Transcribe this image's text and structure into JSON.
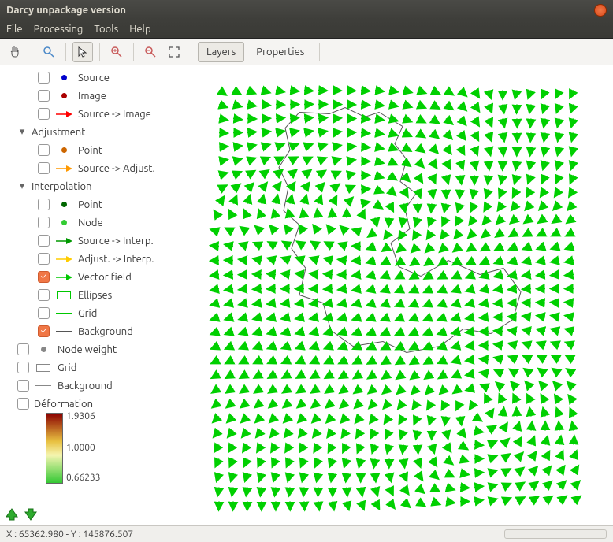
{
  "window": {
    "title": "Darcy unpackage version"
  },
  "menu": {
    "file": "File",
    "processing": "Processing",
    "tools": "Tools",
    "help": "Help"
  },
  "toolbar": {
    "layers": "Layers",
    "properties": "Properties"
  },
  "tree": {
    "source": "Source",
    "image": "Image",
    "source_image": "Source -> Image",
    "adjustment": "Adjustment",
    "adj_point": "Point",
    "adj_source": "Source -> Adjust.",
    "interpolation": "Interpolation",
    "int_point": "Point",
    "int_node": "Node",
    "int_source": "Source -> Interp.",
    "int_adjust": "Adjust. -> Interp.",
    "vector_field": "Vector field",
    "ellipses": "Ellipses",
    "int_grid": "Grid",
    "int_background": "Background",
    "node_weight": "Node weight",
    "grid": "Grid",
    "background": "Background",
    "deformation": "Déformation",
    "grad_max": "1.9306",
    "grad_mid": "1.0000",
    "grad_min": "0.66233"
  },
  "status": {
    "coords": "X : 65362.980 - Y : 145876.507"
  },
  "colors": {
    "vector": "#00d000",
    "source_dot": "#0000cc",
    "image_dot": "#aa0000",
    "adj_point": "#cc6600",
    "int_point": "#006600",
    "int_node": "#33cc33",
    "src_img_arrow": "#ff0000",
    "src_adj_arrow": "#ff9900",
    "src_int_arrow": "#009900",
    "adj_int_arrow": "#ffcc00"
  }
}
